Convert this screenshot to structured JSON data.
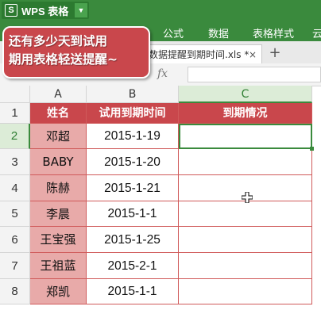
{
  "app": {
    "name": "WPS 表格",
    "logo_letter": "S"
  },
  "menu": [
    "公式",
    "数据",
    "表格样式",
    "云"
  ],
  "document": {
    "tab_label": "数据提醒到期时间.xls *",
    "close_glyph": "×",
    "new_tab_glyph": "+"
  },
  "formula_bar": {
    "fx": "fx",
    "value": ""
  },
  "callout": {
    "line1": "还有多少天到试用",
    "line2": "期用表格轻送提醒~"
  },
  "columns": [
    "A",
    "B",
    "C"
  ],
  "rows": [
    "1",
    "2",
    "3",
    "4",
    "5",
    "6",
    "7",
    "8"
  ],
  "table": {
    "headers": [
      "姓名",
      "试用到期时间",
      "到期情况"
    ],
    "records": [
      {
        "name": "邓超",
        "date": "2015-1-19",
        "status": ""
      },
      {
        "name": "BABY",
        "date": "2015-1-20",
        "status": ""
      },
      {
        "name": "陈赫",
        "date": "2015-1-21",
        "status": ""
      },
      {
        "name": "李晨",
        "date": "2015-1-1",
        "status": ""
      },
      {
        "name": "王宝强",
        "date": "2015-1-25",
        "status": ""
      },
      {
        "name": "王祖蓝",
        "date": "2015-2-1",
        "status": ""
      },
      {
        "name": "郑凯",
        "date": "2015-1-1",
        "status": ""
      }
    ]
  },
  "selection": {
    "cell": "C2"
  },
  "colors": {
    "ribbon_green": "#3a8a3d",
    "header_red": "#c9474c",
    "name_pink": "#e8aaa9",
    "grid_red": "#d05a5a"
  }
}
